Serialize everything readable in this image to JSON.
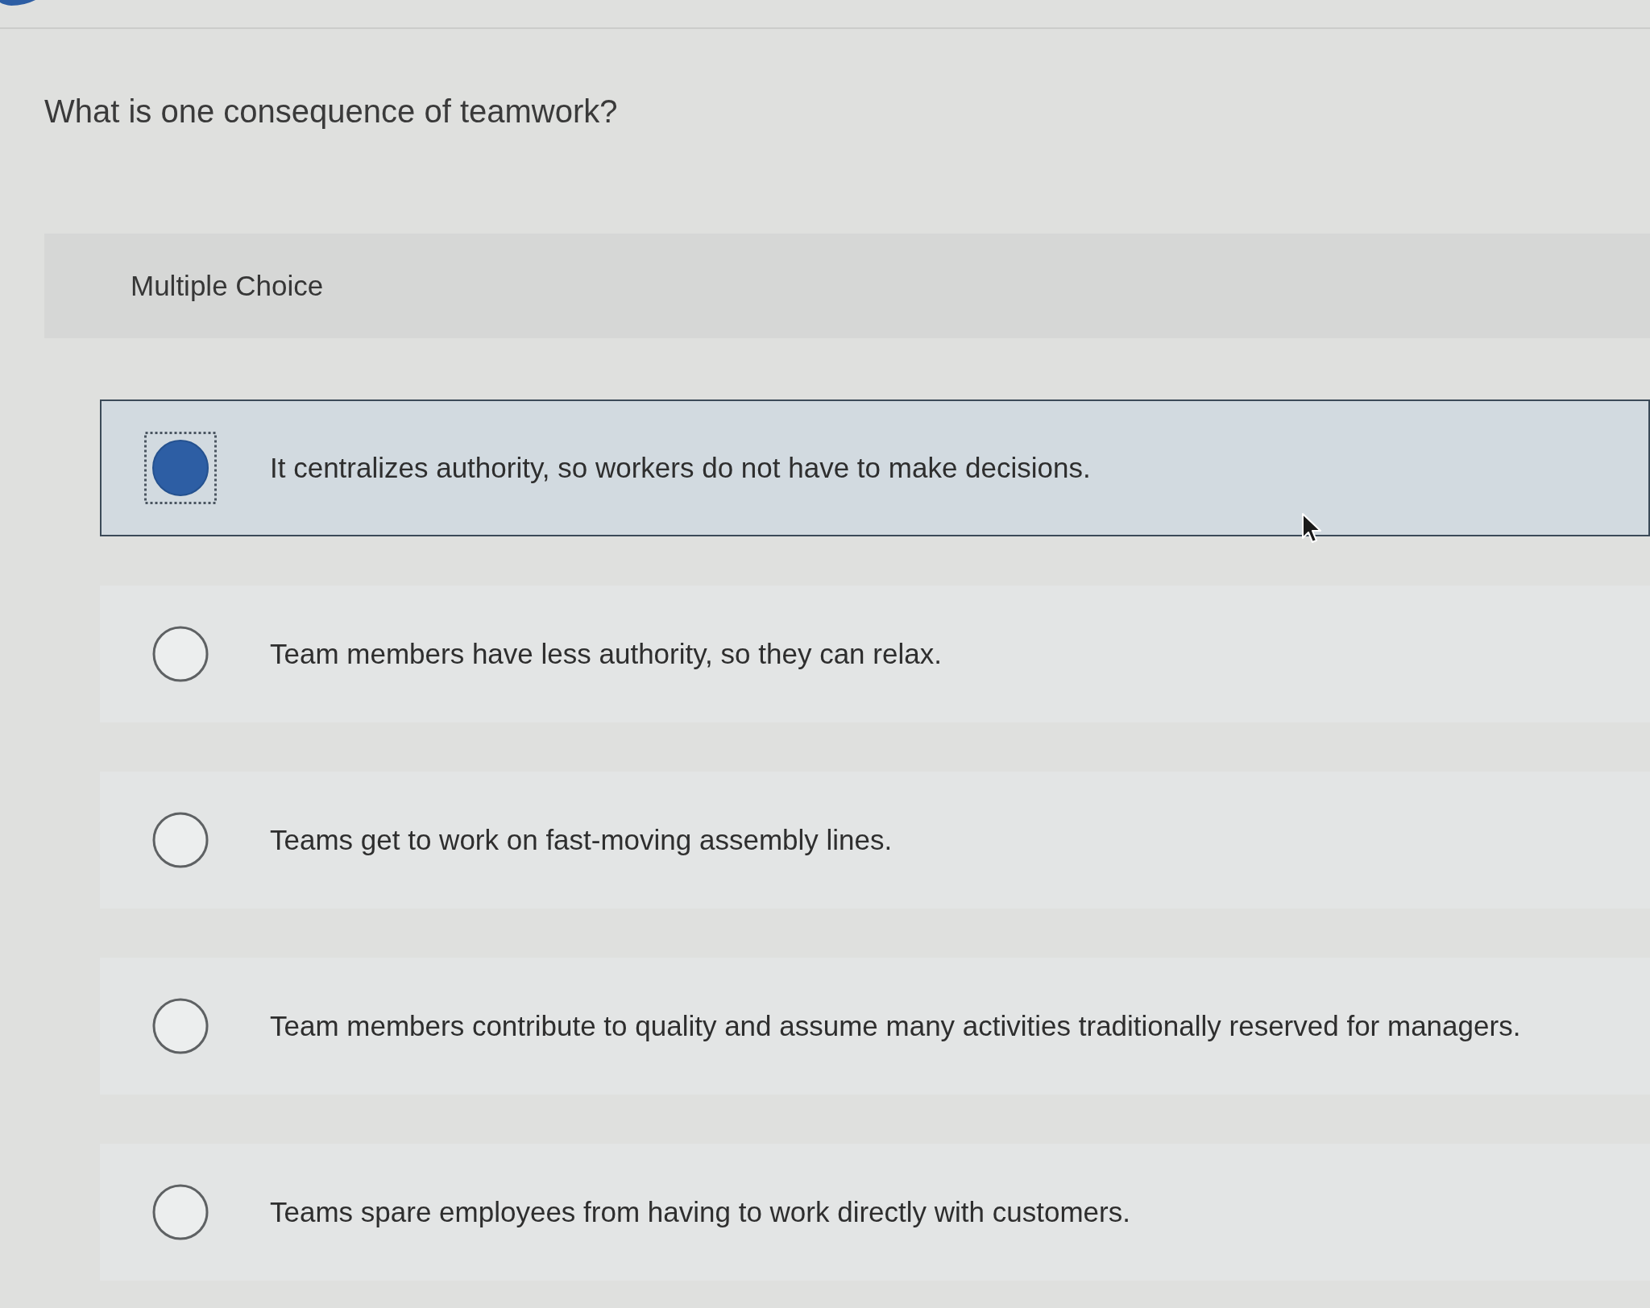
{
  "question": "What is one consequence of teamwork?",
  "question_type": {
    "label": "Multiple Choice"
  },
  "options": [
    {
      "text": "It centralizes authority, so workers do not have to make decisions.",
      "selected": true
    },
    {
      "text": "Team members have less authority, so they can relax.",
      "selected": false
    },
    {
      "text": "Teams get to work on fast-moving assembly lines.",
      "selected": false
    },
    {
      "text": "Team members contribute to quality and assume many activities traditionally reserved for managers.",
      "selected": false
    },
    {
      "text": "Teams spare employees from having to work directly with customers.",
      "selected": false
    }
  ]
}
